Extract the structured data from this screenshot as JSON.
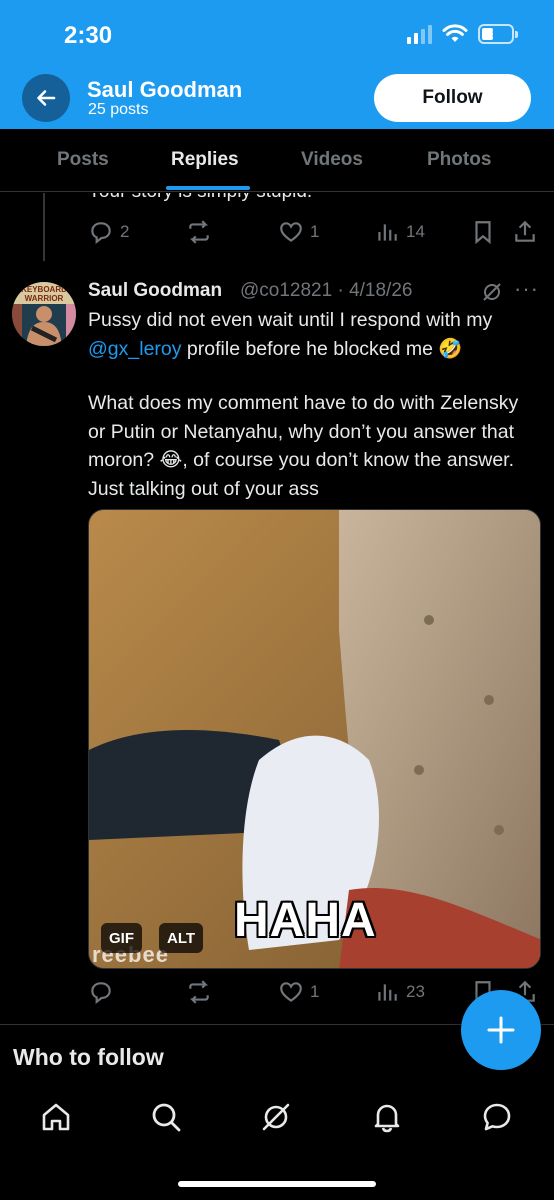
{
  "status_bar": {
    "time": "2:30",
    "battery": "5"
  },
  "header": {
    "name": "Saul Goodman",
    "posts": "25 posts",
    "follow_label": "Follow",
    "back_icon": "arrow-left-icon"
  },
  "tabs": [
    {
      "label": "Posts",
      "active": false
    },
    {
      "label": "Replies",
      "active": true
    },
    {
      "label": "Videos",
      "active": false
    },
    {
      "label": "Photos",
      "active": false
    }
  ],
  "previous_tweet": {
    "text_fragment": "Your story is simply stupid.",
    "replies": "2",
    "likes": "1",
    "views": "14"
  },
  "tweet": {
    "name": "Saul Goodman",
    "handle_date": "@co12821 · 4/18/26",
    "avatar_text": "KEYBOARD WARRIOR",
    "body_line1_pre": "Pussy did not even wait until I respond with my ",
    "mention": "@gx_leroy",
    "body_line1_post": " profile before he blocked me 🤣",
    "body_para2": "What does my comment have to do with Zelensky or Putin or Netanyahu, why don’t you answer that moron? 😂, of course you don’t know the answer. Just talking out of your ass",
    "media": {
      "caption": "HAHA",
      "watermark": "reebee",
      "badge_gif": "GIF",
      "badge_alt": "ALT"
    },
    "likes": "1",
    "views": "23"
  },
  "section": {
    "who_to_follow": "Who to follow"
  },
  "nav": [
    "home-icon",
    "search-icon",
    "grok-icon",
    "notifications-icon",
    "messages-icon"
  ],
  "colors": {
    "accent": "#1d9bf0",
    "background": "#000000",
    "muted": "#71767b"
  }
}
